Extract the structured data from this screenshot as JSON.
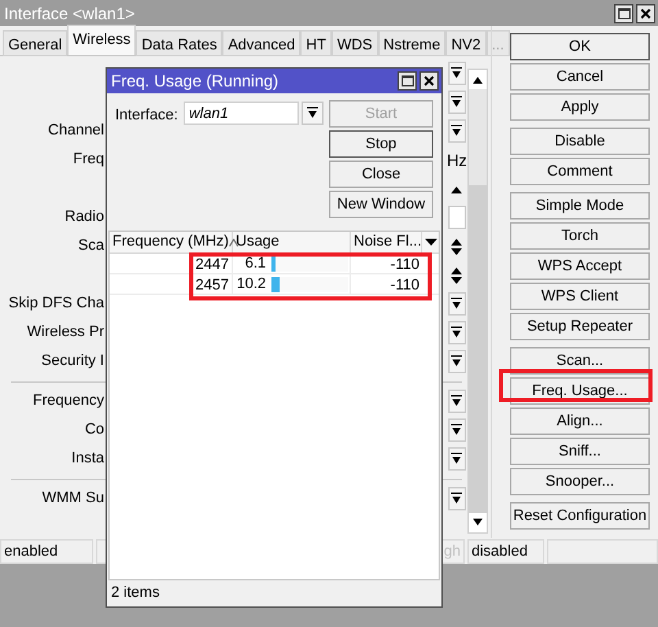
{
  "window": {
    "title": "Interface <wlan1>"
  },
  "tabs": [
    {
      "label": "General",
      "selected": false,
      "disabled": false
    },
    {
      "label": "Wireless",
      "selected": true,
      "disabled": false
    },
    {
      "label": "Data Rates",
      "selected": false,
      "disabled": false
    },
    {
      "label": "Advanced",
      "selected": false,
      "disabled": false
    },
    {
      "label": "HT",
      "selected": false,
      "disabled": false
    },
    {
      "label": "WDS",
      "selected": false,
      "disabled": false
    },
    {
      "label": "Nstreme",
      "selected": false,
      "disabled": false
    },
    {
      "label": "NV2",
      "selected": false,
      "disabled": false
    },
    {
      "label": "...",
      "selected": false,
      "disabled": true
    }
  ],
  "form_rows": [
    {
      "kind": "dropdown"
    },
    {
      "kind": "dropdown"
    },
    {
      "label": "Channel",
      "kind": "dropdown"
    },
    {
      "label": "Freq",
      "kind": "unit",
      "unit": "Hz"
    },
    {
      "kind": "spin_up"
    },
    {
      "label": "Radio",
      "kind": "field"
    },
    {
      "label": "Sca",
      "kind": "spin"
    },
    {
      "kind": "spin"
    },
    {
      "label": "Skip DFS Cha",
      "kind": "dropdown"
    },
    {
      "label": "Wireless Pr",
      "kind": "dropdown"
    },
    {
      "label": "Security I",
      "kind": "dropdown"
    },
    {
      "kind": "divider"
    },
    {
      "label": "Frequency",
      "kind": "dropdown"
    },
    {
      "label": "Co",
      "kind": "dropdown"
    },
    {
      "label": "Insta",
      "kind": "dropdown"
    },
    {
      "kind": "divider"
    },
    {
      "label": "WMM Su",
      "kind": "dropdown"
    }
  ],
  "buttons": [
    [
      {
        "label": "OK",
        "highlighted": false
      },
      {
        "label": "Cancel",
        "highlighted": false
      },
      {
        "label": "Apply",
        "highlighted": false
      }
    ],
    [
      {
        "label": "Disable",
        "highlighted": false
      },
      {
        "label": "Comment",
        "highlighted": false
      }
    ],
    [
      {
        "label": "Simple Mode",
        "highlighted": false
      },
      {
        "label": "Torch",
        "highlighted": false
      },
      {
        "label": "WPS Accept",
        "highlighted": false
      },
      {
        "label": "WPS Client",
        "highlighted": false
      },
      {
        "label": "Setup Repeater",
        "highlighted": false
      }
    ],
    [
      {
        "label": "Scan...",
        "highlighted": false
      },
      {
        "label": "Freq. Usage...",
        "highlighted": true
      },
      {
        "label": "Align...",
        "highlighted": false
      },
      {
        "label": "Sniff...",
        "highlighted": false
      },
      {
        "label": "Snooper...",
        "highlighted": false
      }
    ],
    [
      {
        "label": "Reset Configuration",
        "highlighted": false
      }
    ]
  ],
  "status_bar": [
    {
      "text": "enabled",
      "disabled": false
    },
    {
      "text": "gh",
      "disabled": true
    },
    {
      "text": "disabled",
      "disabled": false
    }
  ],
  "dialog": {
    "title": "Freq. Usage (Running)",
    "interface_label": "Interface:",
    "interface_value": "wlan1",
    "buttons": [
      {
        "label": "Start",
        "disabled": true
      },
      {
        "label": "Stop",
        "disabled": false
      },
      {
        "label": "Close",
        "disabled": false
      },
      {
        "label": "New Window",
        "disabled": false
      }
    ],
    "table": {
      "highlighted": true,
      "columns": [
        {
          "label": "Frequency (MHz)",
          "sorted": true
        },
        {
          "label": "Usage",
          "sorted": false
        },
        {
          "label": "Noise Fl...",
          "sorted": false
        }
      ],
      "rows": [
        {
          "frequency": "2447",
          "usage": "6.1",
          "level": 0.061,
          "noise_floor": "-110"
        },
        {
          "frequency": "2457",
          "usage": "10.2",
          "level": 0.102,
          "noise_floor": "-110"
        }
      ]
    },
    "status": "2 items"
  }
}
